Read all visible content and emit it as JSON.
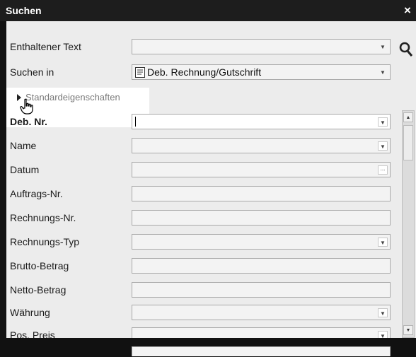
{
  "window": {
    "title": "Suchen",
    "close_glyph": "×"
  },
  "header_fields": [
    {
      "label": "Enthaltener Text",
      "value": ""
    },
    {
      "label": "Suchen in",
      "value": "Deb. Rechnung/Gutschrift",
      "icon": "document-icon"
    }
  ],
  "section": {
    "label": "Standardeigenschaften",
    "icon": "expand-triangle-icon"
  },
  "fields": [
    {
      "label": "Deb. Nr.",
      "control": "dropdown",
      "value": ""
    },
    {
      "label": "Name",
      "control": "dropdown",
      "value": ""
    },
    {
      "label": "Datum",
      "control": "date",
      "value": ""
    },
    {
      "label": "Auftrags-Nr.",
      "control": "text",
      "value": ""
    },
    {
      "label": "Rechnungs-Nr.",
      "control": "text",
      "value": ""
    },
    {
      "label": "Rechnungs-Typ",
      "control": "dropdown",
      "value": ""
    },
    {
      "label": "Brutto-Betrag",
      "control": "text",
      "value": ""
    },
    {
      "label": "Netto-Betrag",
      "control": "text",
      "value": ""
    },
    {
      "label": "Währung",
      "control": "dropdown",
      "value": ""
    },
    {
      "label": "Pos. Preis",
      "control": "dropdown",
      "value": ""
    }
  ]
}
